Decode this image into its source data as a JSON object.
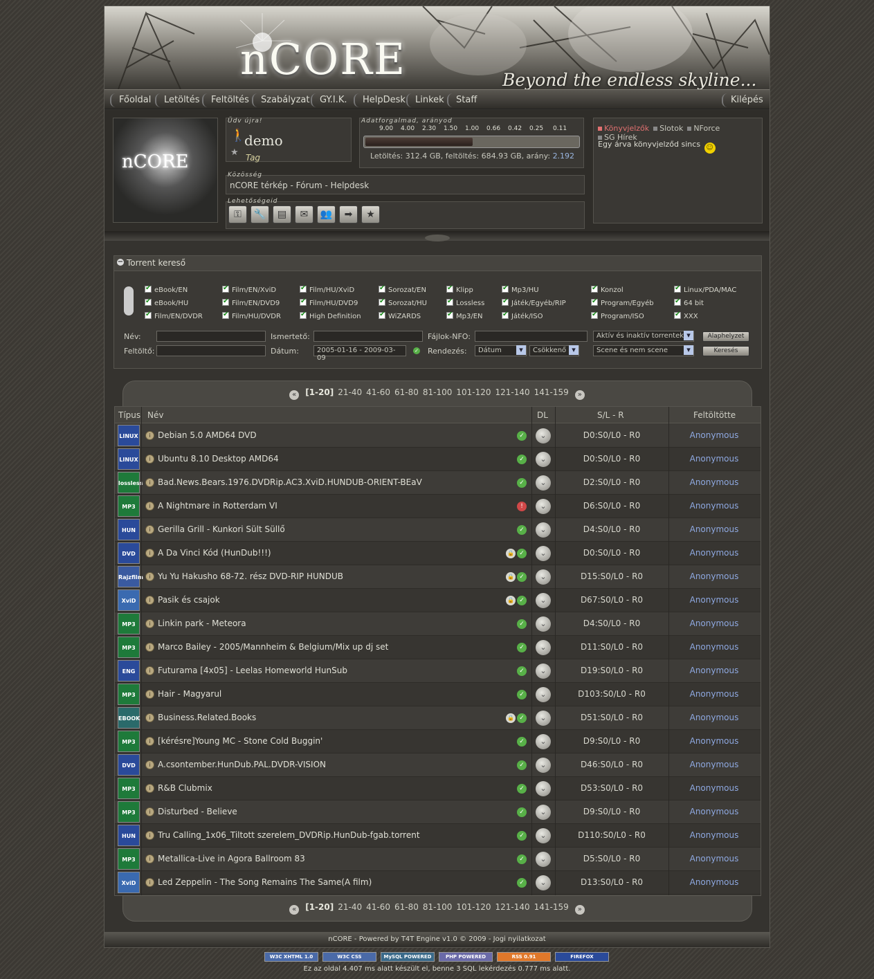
{
  "header": {
    "logo": "nCORE",
    "slogan": "Beyond the endless skyline..."
  },
  "nav": {
    "items": [
      "Főoldal",
      "Letöltés",
      "Feltöltés",
      "Szabályzat",
      "GY.I.K.",
      "HelpDesk",
      "Linkek",
      "Staff"
    ],
    "logout": "Kilépés"
  },
  "user": {
    "welcome_label": "Üdv újra!",
    "name": "demo",
    "rank": "Tag",
    "avatar_text": "nCORE",
    "traffic_label": "Adatforgalmad, arányod",
    "ratio_ticks": [
      "9.00",
      "4.00",
      "2.30",
      "1.50",
      "1.00",
      "0.66",
      "0.42",
      "0.25",
      "0.11"
    ],
    "ratio_fill_fraction": 0.5,
    "traffic_text": "Letöltés: 312.4 GB, feltöltés: 684.93 GB, arány: ",
    "ratio": "2.192",
    "community_label": "Közösség",
    "community_links": "nCORE térkép - Fórum - Helpdesk",
    "options_label": "Lehetőségeid",
    "option_icons": [
      "key-icon",
      "wrench-icon",
      "document-icon",
      "envelope-icon",
      "people-icon",
      "arrow-right-icon",
      "star-icon"
    ]
  },
  "sidebox": {
    "tabs": [
      "Könyvjelzők",
      "Slotok",
      "NForce",
      "SG Hírek"
    ],
    "active_tab": "Könyvjelzők",
    "message": "Egy árva könyvjelződ sincs"
  },
  "search": {
    "title": "Torrent kereső",
    "categories": [
      [
        "eBook/EN",
        "eBook/HU",
        "Film/EN/DVDR"
      ],
      [
        "Film/EN/XviD",
        "Film/EN/DVD9",
        "Film/HU/DVDR"
      ],
      [
        "Film/HU/XviD",
        "Film/HU/DVD9",
        "High Definition"
      ],
      [
        "Sorozat/EN",
        "Sorozat/HU",
        "WiZARDS"
      ],
      [
        "Klipp",
        "Lossless",
        "Mp3/EN"
      ],
      [
        "Mp3/HU",
        "Játék/Egyéb/RIP",
        "Játék/ISO"
      ],
      [
        "Konzol",
        "Program/Egyéb",
        "Program/ISO"
      ],
      [
        "Linux/PDA/MAC",
        "64 bit",
        "XXX"
      ]
    ],
    "labels": {
      "name": "Név:",
      "uploader": "Feltöltő:",
      "description": "Ismertető:",
      "date": "Dátum:",
      "nfo": "Fájlok-NFO:",
      "sort": "Rendezés:"
    },
    "date_value": "2005-01-16 - 2009-03-09",
    "active_select": "Aktív és inaktív torrentek",
    "sort_field": "Dátum",
    "sort_dir": "Csökkenő",
    "scene_select": "Scene és nem scene",
    "reset_button": "Alaphelyzet",
    "search_button": "Keresés"
  },
  "pager": {
    "current": "[1-20]",
    "pages": [
      "21-40",
      "41-60",
      "61-80",
      "81-100",
      "101-120",
      "121-140",
      "141-159"
    ]
  },
  "table": {
    "headers": {
      "type": "Típus",
      "name": "Név",
      "dl": "DL",
      "sl": "S/L - R",
      "uploader": "Feltöltötte"
    },
    "rows": [
      {
        "type": "LINUX",
        "color": "#2a4a9a",
        "name": "Debian 5.0 AMD64 DVD",
        "lock": false,
        "status": "ok",
        "sl": "D0:S0/L0 - R0",
        "uploader": "Anonymous"
      },
      {
        "type": "LINUX",
        "color": "#2a4a9a",
        "name": "Ubuntu 8.10 Desktop AMD64",
        "lock": false,
        "status": "ok",
        "sl": "D0:S0/L0 - R0",
        "uploader": "Anonymous"
      },
      {
        "type": "lossless",
        "color": "#1e7a3a",
        "name": "Bad.News.Bears.1976.DVDRip.AC3.XviD.HUNDUB-ORIENT-BEaV",
        "lock": false,
        "status": "ok",
        "sl": "D2:S0/L0 - R0",
        "uploader": "Anonymous"
      },
      {
        "type": "MP3",
        "color": "#1e7a3a",
        "name": "A Nightmare in Rotterdam VI",
        "lock": false,
        "status": "warn",
        "sl": "D6:S0/L0 - R0",
        "uploader": "Anonymous"
      },
      {
        "type": "HUN",
        "color": "#2a4a9a",
        "name": "Gerilla Grill - Kunkori Sült Süllő",
        "lock": false,
        "status": "ok",
        "sl": "D4:S0/L0 - R0",
        "uploader": "Anonymous"
      },
      {
        "type": "DVD",
        "color": "#2a4a9a",
        "name": "A Da Vinci Kód (HunDub!!!)",
        "lock": true,
        "status": "ok",
        "sl": "D0:S0/L0 - R0",
        "uploader": "Anonymous"
      },
      {
        "type": "Rajzfilm",
        "color": "#3a5aa0",
        "name": "Yu Yu Hakusho 68-72. rész DVD-RIP HUNDUB",
        "lock": true,
        "status": "ok",
        "sl": "D15:S0/L0 - R0",
        "uploader": "Anonymous"
      },
      {
        "type": "XviD",
        "color": "#3a6ab0",
        "name": "Pasik és csajok",
        "lock": true,
        "status": "ok",
        "sl": "D67:S0/L0 - R0",
        "uploader": "Anonymous"
      },
      {
        "type": "MP3",
        "color": "#1e7a3a",
        "name": "Linkin park - Meteora",
        "lock": false,
        "status": "ok",
        "sl": "D4:S0/L0 - R0",
        "uploader": "Anonymous"
      },
      {
        "type": "MP3",
        "color": "#1e7a3a",
        "name": "Marco Bailey - 2005/Mannheim & Belgium/Mix up dj set",
        "lock": false,
        "status": "ok",
        "sl": "D11:S0/L0 - R0",
        "uploader": "Anonymous"
      },
      {
        "type": "ENG",
        "color": "#2a4a9a",
        "name": "Futurama [4x05] - Leelas Homeworld HunSub",
        "lock": false,
        "status": "ok",
        "sl": "D19:S0/L0 - R0",
        "uploader": "Anonymous"
      },
      {
        "type": "MP3",
        "color": "#1e7a3a",
        "name": "Hair - Magyarul",
        "lock": false,
        "status": "ok",
        "sl": "D103:S0/L0 - R0",
        "uploader": "Anonymous"
      },
      {
        "type": "EBOOK",
        "color": "#2a6a6a",
        "name": "Business.Related.Books",
        "lock": true,
        "status": "ok",
        "sl": "D51:S0/L0 - R0",
        "uploader": "Anonymous"
      },
      {
        "type": "MP3",
        "color": "#1e7a3a",
        "name": "[kérésre]Young MC - Stone Cold Buggin'",
        "lock": false,
        "status": "ok",
        "sl": "D9:S0/L0 - R0",
        "uploader": "Anonymous"
      },
      {
        "type": "DVD",
        "color": "#2a4a9a",
        "name": "A.csontember.HunDub.PAL.DVDR-VISION",
        "lock": false,
        "status": "ok",
        "sl": "D46:S0/L0 - R0",
        "uploader": "Anonymous"
      },
      {
        "type": "MP3",
        "color": "#1e7a3a",
        "name": "R&B Clubmix",
        "lock": false,
        "status": "ok",
        "sl": "D53:S0/L0 - R0",
        "uploader": "Anonymous"
      },
      {
        "type": "MP3",
        "color": "#1e7a3a",
        "name": "Disturbed - Believe",
        "lock": false,
        "status": "ok",
        "sl": "D9:S0/L0 - R0",
        "uploader": "Anonymous"
      },
      {
        "type": "HUN",
        "color": "#2a4a9a",
        "name": "Tru Calling_1x06_Tiltott szerelem_DVDRip.HunDub-fgab.torrent",
        "lock": false,
        "status": "ok",
        "sl": "D110:S0/L0 - R0",
        "uploader": "Anonymous"
      },
      {
        "type": "MP3",
        "color": "#1e7a3a",
        "name": "Metallica-Live in Agora Ballroom 83",
        "lock": false,
        "status": "ok",
        "sl": "D5:S0/L0 - R0",
        "uploader": "Anonymous"
      },
      {
        "type": "XviD",
        "color": "#3a6ab0",
        "name": "Led Zeppelin - The Song Remains The Same(A film)",
        "lock": false,
        "status": "ok",
        "sl": "D13:S0/L0 - R0",
        "uploader": "Anonymous"
      }
    ]
  },
  "footer": {
    "text": "nCORE - Powered by T4T Engine v1.0 © 2009 - Jogi nyilatkozat",
    "badges": [
      {
        "label": "W3C XHTML 1.0",
        "color": "#4a6aa8"
      },
      {
        "label": "W3C CSS",
        "color": "#4a6aa8"
      },
      {
        "label": "MySQL POWERED",
        "color": "#3a6a8a"
      },
      {
        "label": "PHP POWERED",
        "color": "#6a6aa8"
      },
      {
        "label": "RSS 0.91",
        "color": "#e0782a"
      },
      {
        "label": "FIREFOX",
        "color": "#2a4a9a"
      }
    ],
    "generated": "Ez az oldal 4.407 ms alatt készült el, benne 3 SQL lekérdezés 0.777 ms alatt."
  }
}
